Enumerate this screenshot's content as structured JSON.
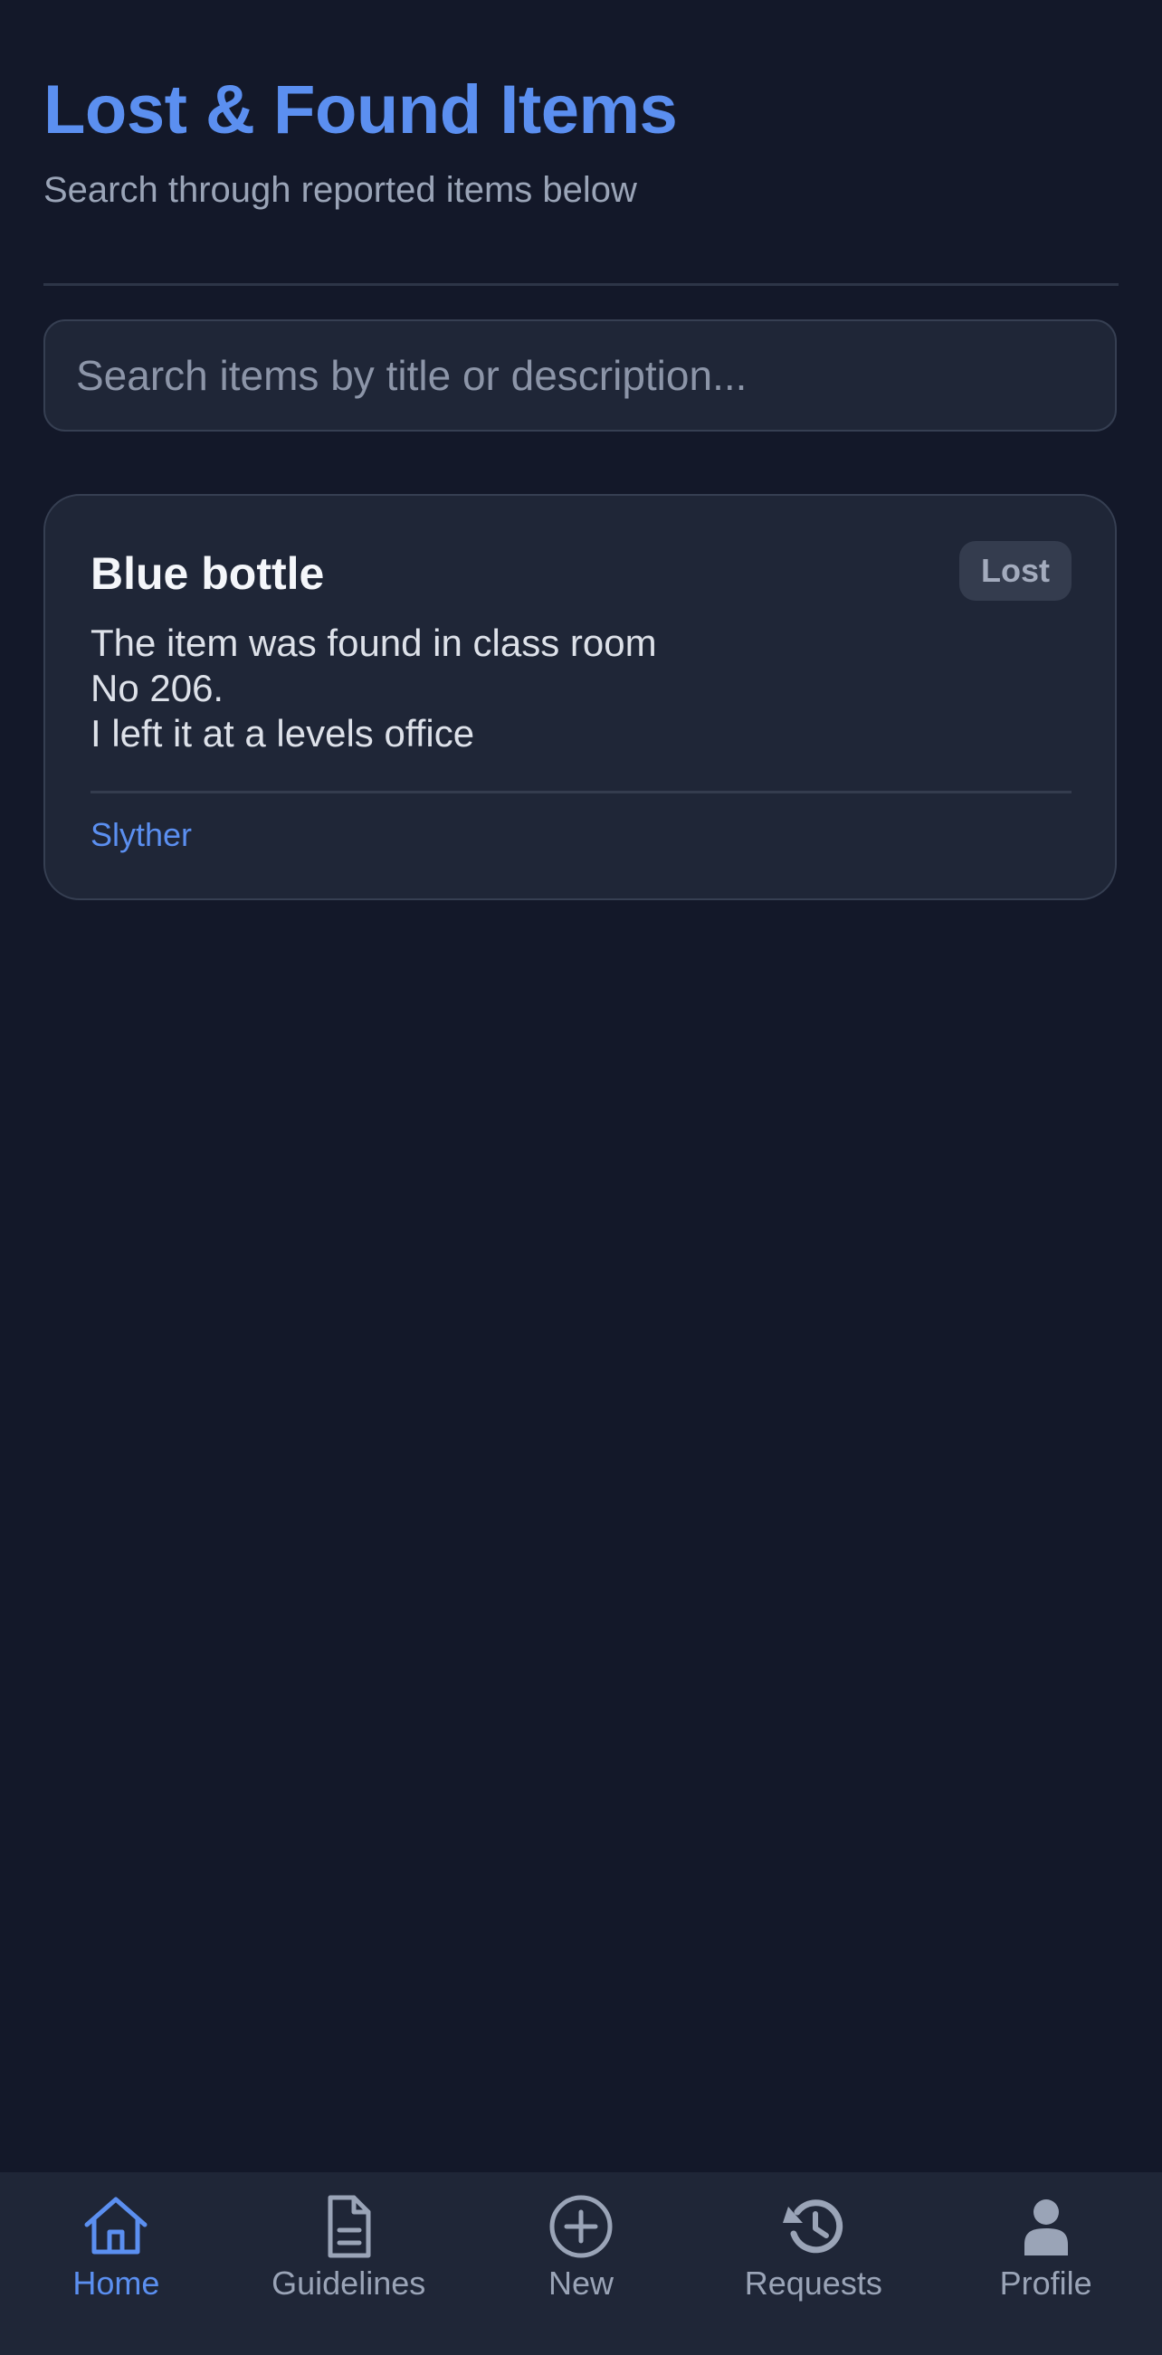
{
  "header": {
    "title": "Lost & Found Items",
    "subtitle": "Search through reported items below"
  },
  "search": {
    "placeholder": "Search items by title or description...",
    "value": ""
  },
  "items": [
    {
      "title": "Blue bottle",
      "status": "Lost",
      "description": "The item was found in class room\nNo 206.\nI left it at a levels office",
      "author": "Slyther"
    }
  ],
  "nav": {
    "items": [
      {
        "label": "Home",
        "icon": "home-icon",
        "active": true
      },
      {
        "label": "Guidelines",
        "icon": "document-icon",
        "active": false
      },
      {
        "label": "New",
        "icon": "plus-circle-icon",
        "active": false
      },
      {
        "label": "Requests",
        "icon": "history-icon",
        "active": false
      },
      {
        "label": "Profile",
        "icon": "user-icon",
        "active": false
      }
    ]
  },
  "colors": {
    "background": "#131829",
    "surface": "#1f2637",
    "accent": "#5b8ff0",
    "muted_text": "#9aa4b7",
    "badge_background": "#343c4e"
  }
}
